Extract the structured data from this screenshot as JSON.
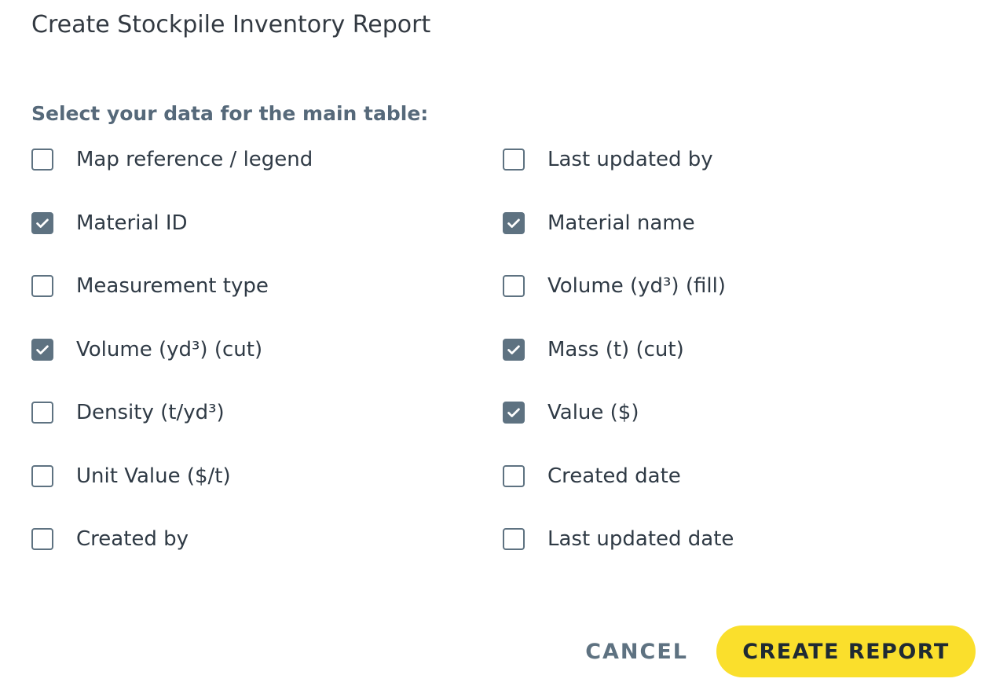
{
  "dialog": {
    "title": "Create Stockpile Inventory Report",
    "section_label": "Select your data for the main table:"
  },
  "options": [
    {
      "label": "Map reference / legend",
      "checked": false
    },
    {
      "label": "Last updated by",
      "checked": false
    },
    {
      "label": "Material ID",
      "checked": true
    },
    {
      "label": "Material name",
      "checked": true
    },
    {
      "label": "Measurement type",
      "checked": false
    },
    {
      "label": "Volume (yd³) (fill)",
      "checked": false
    },
    {
      "label": "Volume (yd³) (cut)",
      "checked": true
    },
    {
      "label": "Mass (t) (cut)",
      "checked": true
    },
    {
      "label": "Density (t/yd³)",
      "checked": false
    },
    {
      "label": "Value ($)",
      "checked": true
    },
    {
      "label": "Unit Value ($/t)",
      "checked": false
    },
    {
      "label": "Created date",
      "checked": false
    },
    {
      "label": "Created by",
      "checked": false
    },
    {
      "label": "Last updated date",
      "checked": false
    }
  ],
  "actions": {
    "cancel_label": "CANCEL",
    "create_label": "CREATE REPORT"
  },
  "colors": {
    "accent": "#fadf2c",
    "checkbox": "#5e7281",
    "section_label": "#56697a"
  },
  "icons": {
    "checkbox_checked": "check-icon"
  }
}
